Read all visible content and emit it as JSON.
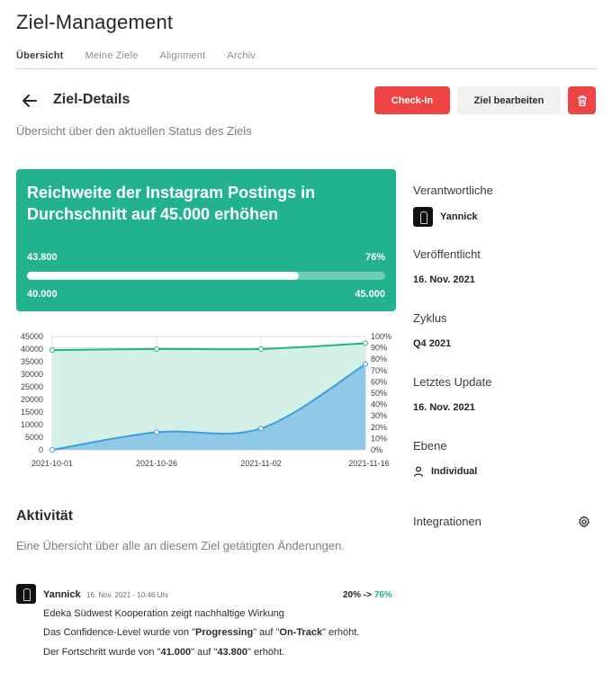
{
  "app": {
    "title": "Ziel-Management"
  },
  "tabs": [
    {
      "label": "Übersicht",
      "active": true
    },
    {
      "label": "Meine Ziele",
      "active": false
    },
    {
      "label": "Alignment",
      "active": false
    },
    {
      "label": "Archiv",
      "active": false
    }
  ],
  "header": {
    "title": "Ziel-Details",
    "subtitle": "Übersicht über den aktuellen Status des Ziels",
    "checkin_label": "Check-In",
    "edit_label": "Ziel bearbeiten",
    "back_icon": "arrow-left-icon",
    "delete_icon": "trash-icon"
  },
  "goal": {
    "title": "Reichweite der Instagram Postings in Durchschnitt auf 45.000 erhöhen",
    "current": "43.800",
    "percent_label": "76%",
    "progress": 0.76,
    "start": "40.000",
    "target": "45.000",
    "color": "#22b28f"
  },
  "chart_data": {
    "type": "area",
    "x": [
      "2021-10-01",
      "2021-10-26",
      "2021-11-02",
      "2021-11-16"
    ],
    "series": [
      {
        "axis": "left",
        "values": [
          0,
          7000,
          8500,
          34000
        ],
        "color": "#3b9ede"
      },
      {
        "axis": "right",
        "values": [
          88,
          89,
          89,
          94
        ],
        "color": "#22b28f"
      }
    ],
    "y_left_ticks": [
      "45000",
      "40000",
      "35000",
      "30000",
      "25000",
      "20000",
      "15000",
      "10000",
      "5000",
      "0"
    ],
    "y_right_ticks": [
      "100%",
      "90%",
      "80%",
      "70%",
      "60%",
      "50%",
      "40%",
      "30%",
      "20%",
      "10%",
      "0%"
    ],
    "ylim_left": [
      0,
      45000
    ],
    "ylim_right": [
      0,
      100
    ],
    "grid": true
  },
  "sidebar": {
    "owners_label": "Verantwortliche",
    "owner_name": "Yannick",
    "published_label": "Veröffentlicht",
    "published_value": "16. Nov. 2021",
    "cycle_label": "Zyklus",
    "cycle_value": "Q4 2021",
    "updated_label": "Letztes Update",
    "updated_value": "16. Nov. 2021",
    "level_label": "Ebene",
    "level_value": "Individual",
    "integrations_label": "Integrationen"
  },
  "activity": {
    "title": "Aktivität",
    "subtitle": "Eine Übersicht über alle an diesem Ziel getätigten Änderungen.",
    "entries": [
      {
        "user": "Yannick",
        "time": "16. Nov. 2021 - 10:46 Uhr",
        "change_from": "20%",
        "change_arrow": "->",
        "change_to": "76%",
        "comment": "Edeka Südwest Kooperation zeigt nachhaltige Wirkung",
        "confidence_prefix": "Das Confidence-Level wurde von \"",
        "confidence_from": "Progressing",
        "confidence_mid": "\" auf \"",
        "confidence_to": "On-Track",
        "confidence_suffix": "\" erhöht.",
        "progress_prefix": "Der Fortschritt wurde von \"",
        "progress_from": "41.000",
        "progress_mid": "\" auf \"",
        "progress_to": "43.800",
        "progress_suffix": "\" erhöht."
      }
    ]
  }
}
